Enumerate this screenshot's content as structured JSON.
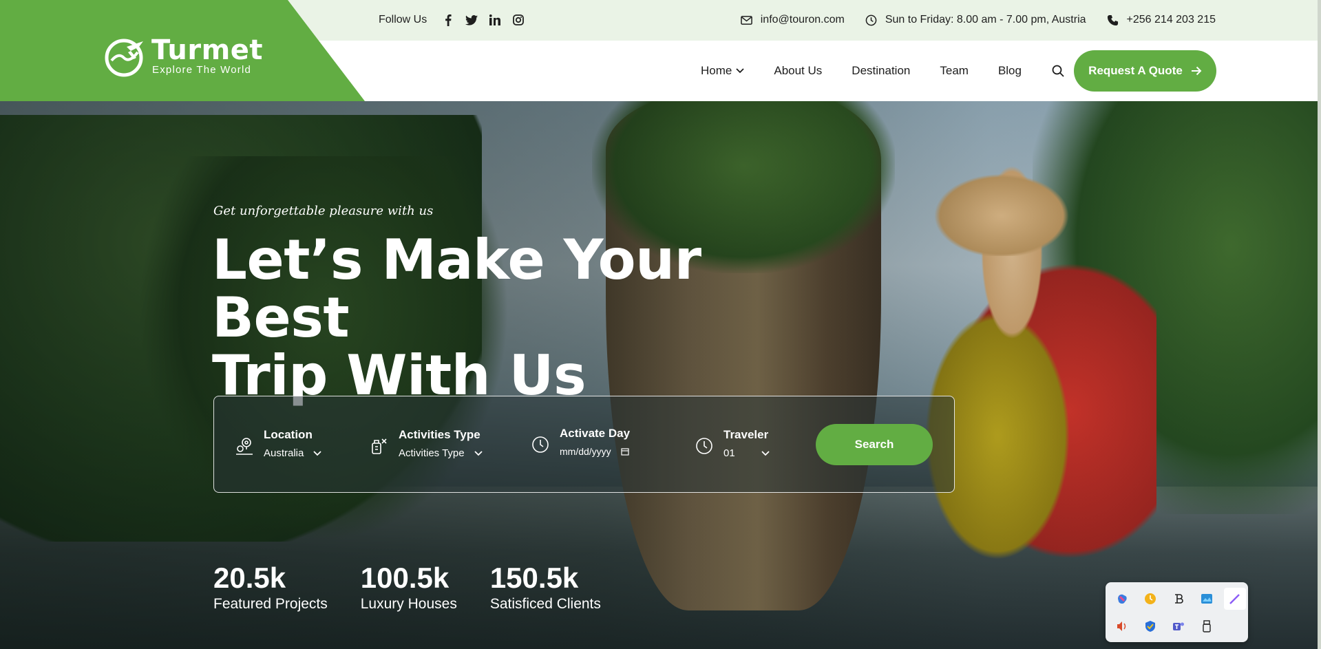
{
  "brand": {
    "name": "Turmet",
    "tagline": "Explore The World",
    "color": "#62ad43"
  },
  "topbar": {
    "follow_label": "Follow Us",
    "socials": [
      "facebook-icon",
      "twitter-icon",
      "linkedin-icon",
      "instagram-icon"
    ],
    "email": "info@touron.com",
    "hours": "Sun to Friday: 8.00 am - 7.00 pm, Austria",
    "phone": "+256 214 203 215"
  },
  "nav": {
    "items": [
      {
        "label": "Home",
        "has_dropdown": true
      },
      {
        "label": "About Us"
      },
      {
        "label": "Destination"
      },
      {
        "label": "Team"
      },
      {
        "label": "Blog"
      }
    ],
    "cta_label": "Request A Quote"
  },
  "hero": {
    "subtitle": "Get unforgettable pleasure with us",
    "headline_line1": "Let’s Make Your Best",
    "headline_line2": "Trip With Us"
  },
  "search": {
    "fields": [
      {
        "label": "Location",
        "value": "Australia",
        "icon": "location-pin-icon"
      },
      {
        "label": "Activities Type",
        "value": "Activities Type",
        "icon": "activities-icon"
      },
      {
        "label": "Activate Day",
        "value": "mm/dd/yyyy",
        "icon": "clock-icon"
      },
      {
        "label": "Traveler",
        "value": "01",
        "icon": "clock-icon"
      }
    ],
    "button_label": "Search"
  },
  "stats": [
    {
      "value": "20.5k",
      "label": "Featured Projects"
    },
    {
      "value": "100.5k",
      "label": "Luxury Houses"
    },
    {
      "value": "150.5k",
      "label": "Satisficed Clients"
    }
  ],
  "tray": {
    "icons": [
      "copilot-icon",
      "clock-icon",
      "app-icon",
      "photos-icon",
      "pen-icon",
      "volume-icon",
      "shield-icon",
      "teams-icon",
      "usb-icon"
    ]
  }
}
